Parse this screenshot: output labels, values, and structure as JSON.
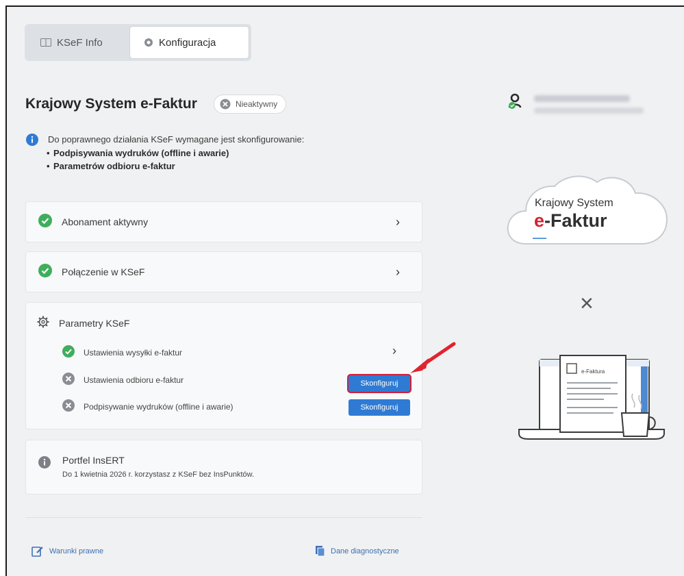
{
  "tabs": [
    {
      "label": "KSeF Info",
      "icon": "book-icon",
      "active": false
    },
    {
      "label": "Konfiguracja",
      "icon": "gear-icon",
      "active": true
    }
  ],
  "header": {
    "title": "Krajowy System e-Faktur",
    "status": "Nieaktywny"
  },
  "info": {
    "text": "Do poprawnego działania KSeF wymagane jest skonfigurowanie:",
    "items": [
      "Podpisywania wydruków (offline i awarie)",
      "Parametrów odbioru e-faktur"
    ]
  },
  "cards": {
    "subscription": "Abonament aktywny",
    "connection": "Połączenie w KSeF"
  },
  "parameters": {
    "title": "Parametry KSeF",
    "items": [
      {
        "label": "Ustawienia wysyłki e-faktur",
        "status": "ok"
      },
      {
        "label": "Ustawienia odbioru e-faktur",
        "status": "inactive",
        "button": "Skonfiguruj"
      },
      {
        "label": "Podpisywanie wydruków (offline i awarie)",
        "status": "inactive",
        "button": "Skonfiguruj"
      }
    ]
  },
  "portfel": {
    "title": "Portfel InsERT",
    "text": "Do 1 kwietnia 2026 r. korzystasz z KSeF bez InsPunktów."
  },
  "footer": {
    "legal": "Warunki prawne",
    "diagnostics": "Dane diagnostyczne"
  },
  "illustration": {
    "cloud_line1": "Krajowy System",
    "cloud_prefix": "e",
    "cloud_line2": "-Faktur",
    "times": "×",
    "laptop_doc": "e-Faktura"
  },
  "colors": {
    "accent": "#2f7bd4",
    "success": "#3fae5c",
    "inactive": "#8a8e93",
    "brand_red": "#d42331"
  }
}
